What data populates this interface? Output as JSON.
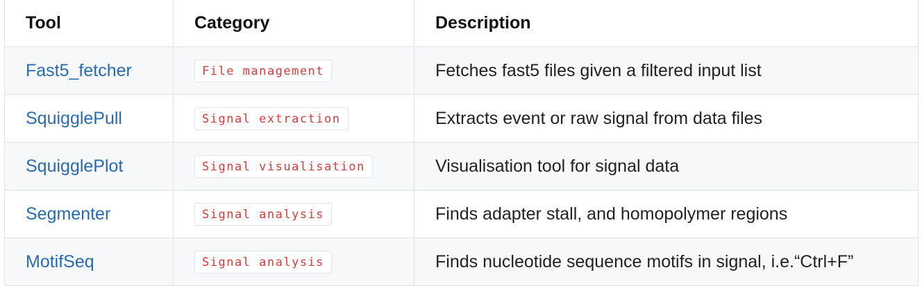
{
  "table": {
    "headers": {
      "tool": "Tool",
      "category": "Category",
      "description": "Description"
    },
    "rows": [
      {
        "tool": "Fast5_fetcher",
        "category": "File management",
        "description": "Fetches fast5 files given a filtered input list"
      },
      {
        "tool": "SquigglePull",
        "category": "Signal extraction",
        "description": "Extracts event or raw signal from data files"
      },
      {
        "tool": "SquigglePlot",
        "category": "Signal visualisation",
        "description": "Visualisation tool for signal data"
      },
      {
        "tool": "Segmenter",
        "category": "Signal analysis",
        "description": "Finds adapter stall, and homopolymer regions"
      },
      {
        "tool": "MotifSeq",
        "category": "Signal analysis",
        "description": "Finds nucleotide sequence motifs in signal, i.e.“Ctrl+F”"
      }
    ]
  },
  "colors": {
    "link": "#2a6bb0",
    "code_text": "#d73a3a",
    "row_stripe": "#f6f8fa",
    "border": "#dfe2e5"
  }
}
